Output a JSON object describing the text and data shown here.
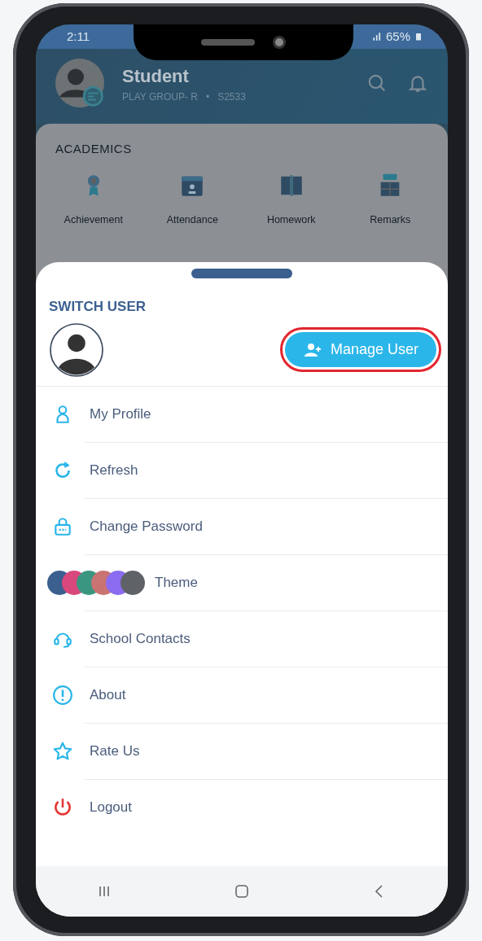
{
  "status_bar": {
    "time": "2:11",
    "battery": "65%"
  },
  "header": {
    "title": "Student",
    "class_name": "PLAY GROUP- R",
    "separator": "•",
    "code": "S2533"
  },
  "academics": {
    "title": "ACADEMICS",
    "items": [
      {
        "label": "Achievement",
        "kind": "medal"
      },
      {
        "label": "Attendance",
        "kind": "calendar"
      },
      {
        "label": "Homework",
        "kind": "book"
      },
      {
        "label": "Remarks",
        "kind": "board"
      }
    ]
  },
  "sheet": {
    "title": "SWITCH USER",
    "manage_button": {
      "label": "Manage User",
      "highlighted": true
    },
    "menu": [
      {
        "label": "My Profile",
        "kind": "profile"
      },
      {
        "label": "Refresh",
        "kind": "refresh"
      },
      {
        "label": "Change Password",
        "kind": "lock"
      },
      {
        "label": "Theme",
        "kind": "theme",
        "swatches": [
          {
            "color": "#3b5f8f"
          },
          {
            "color": "#d9487c"
          },
          {
            "color": "#3a9680"
          },
          {
            "color": "#c97373"
          },
          {
            "color": "#8b6cf0"
          },
          {
            "color": "#5f6368"
          }
        ]
      },
      {
        "label": "School Contacts",
        "kind": "headset"
      },
      {
        "label": "About",
        "kind": "info"
      },
      {
        "label": "Rate Us",
        "kind": "star"
      },
      {
        "label": "Logout",
        "kind": "power"
      }
    ]
  }
}
